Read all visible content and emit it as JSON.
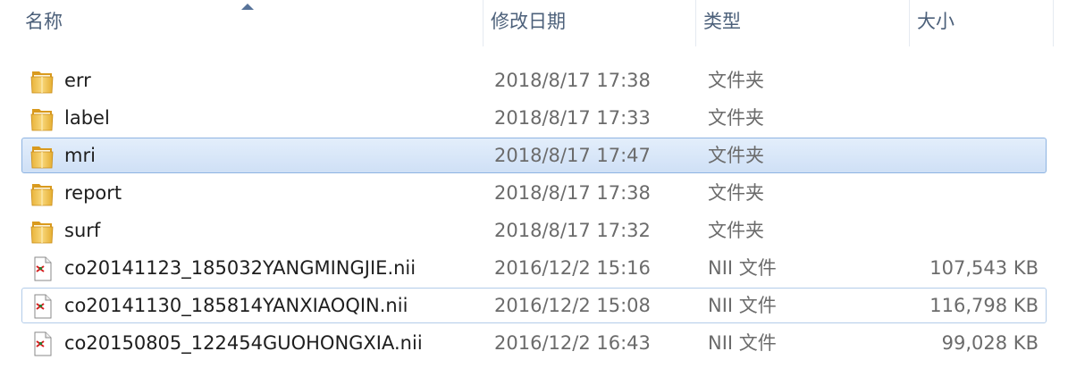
{
  "columns": {
    "name": "名称",
    "date": "修改日期",
    "type": "类型",
    "size": "大小"
  },
  "files": [
    {
      "name": "err",
      "date": "2018/8/17 17:38",
      "type": "文件夹",
      "size": "",
      "icon": "folder-icon"
    },
    {
      "name": "label",
      "date": "2018/8/17 17:33",
      "type": "文件夹",
      "size": "",
      "icon": "folder-icon"
    },
    {
      "name": "mri",
      "date": "2018/8/17 17:47",
      "type": "文件夹",
      "size": "",
      "icon": "folder-icon",
      "selected": true
    },
    {
      "name": "report",
      "date": "2018/8/17 17:38",
      "type": "文件夹",
      "size": "",
      "icon": "folder-icon"
    },
    {
      "name": "surf",
      "date": "2018/8/17 17:32",
      "type": "文件夹",
      "size": "",
      "icon": "folder-icon"
    },
    {
      "name": "co20141123_185032YANGMINGJIE.nii",
      "date": "2016/12/2 15:16",
      "type": "NII 文件",
      "size": "107,543 KB",
      "icon": "nii-file-icon"
    },
    {
      "name": "co20141130_185814YANXIAOQIN.nii",
      "date": "2016/12/2 15:08",
      "type": "NII 文件",
      "size": "116,798 KB",
      "icon": "nii-file-icon",
      "focused": true
    },
    {
      "name": "co20150805_122454GUOHONGXIA.nii",
      "date": "2016/12/2 16:43",
      "type": "NII 文件",
      "size": "99,028 KB",
      "icon": "nii-file-icon"
    }
  ],
  "colors": {
    "selection_fill": "#cfe0f6",
    "selection_border": "#8eb4e2",
    "header_text": "#4c607a",
    "secondary_text": "#6b6b6b"
  }
}
